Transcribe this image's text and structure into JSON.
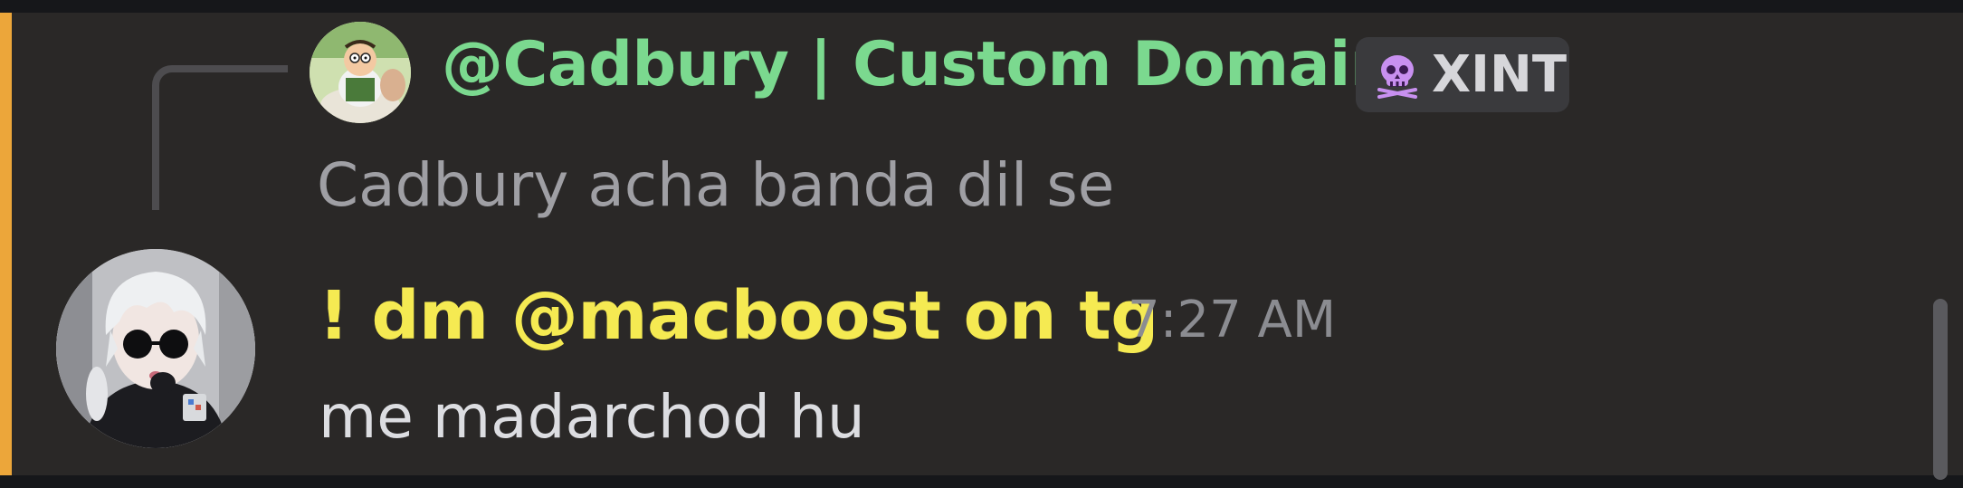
{
  "reply": {
    "author": "@Cadbury | Custom Domains",
    "tag_icon": "skull-icon",
    "tag_label": "XINT",
    "content": "Cadbury acha banda dil se",
    "author_color": "#7bd98f"
  },
  "message": {
    "author": "! dm @macboost on tg",
    "timestamp": "7:27 AM",
    "content": "me madarchod hu",
    "author_color": "#f5ea52"
  },
  "colors": {
    "mention_highlight": "#eca63a",
    "background": "#2a2827"
  }
}
